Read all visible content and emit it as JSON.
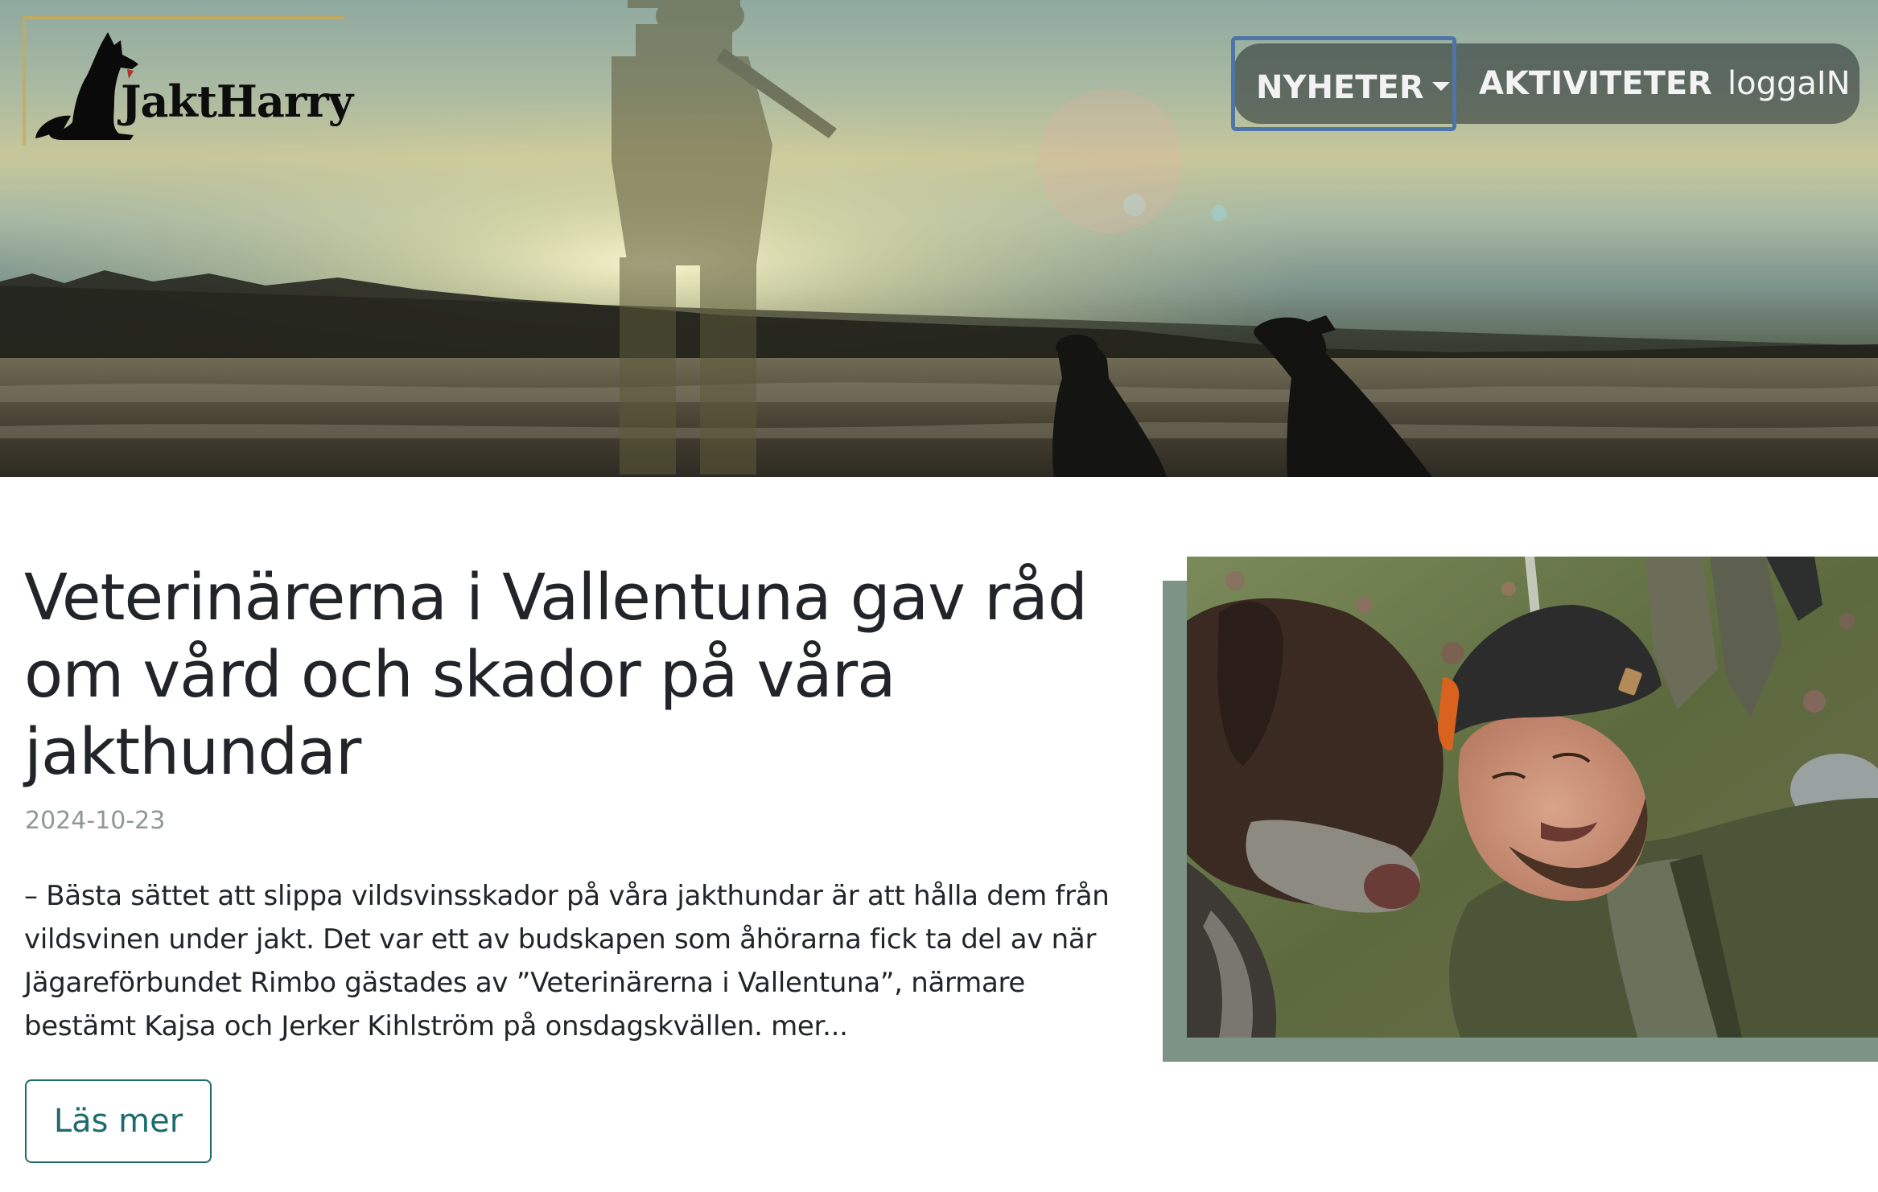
{
  "brand": {
    "name": "JaktHarry",
    "logo_icon": "dog-silhouette-icon"
  },
  "nav": {
    "items": [
      {
        "label": "NYHETER",
        "has_dropdown": true,
        "icon": "caret-down-icon",
        "focused": true
      },
      {
        "label": "AKTIVITETER"
      },
      {
        "label": "loggaIN"
      }
    ]
  },
  "hero": {
    "image": "hunter-with-two-dogs-at-sunset-photo"
  },
  "article": {
    "title": "Veterinärerna i Vallentuna gav råd om vård och skador på våra jakthundar",
    "date": "2024-10-23",
    "excerpt": "– Bästa sättet att slippa vildsvinsskador på våra jakthundar är att hålla dem från vildsvinen under jakt. Det var ett av budskapen som åhörarna fick ta del av när Jägareförbundet Rimbo gästades av ”Veterinärerna i Vallentuna”, närmare bestämt Kajsa och Jerker Kihlström på onsdagskvällen. mer...",
    "read_more_label": "Läs mer",
    "image": "man-and-hunting-dog-resting-photo"
  },
  "colors": {
    "accent": "#1d6b6d",
    "image_shadow": "#7d9386",
    "nav_focus": "#4f74a8",
    "logo_frame": "#c9aa54"
  }
}
